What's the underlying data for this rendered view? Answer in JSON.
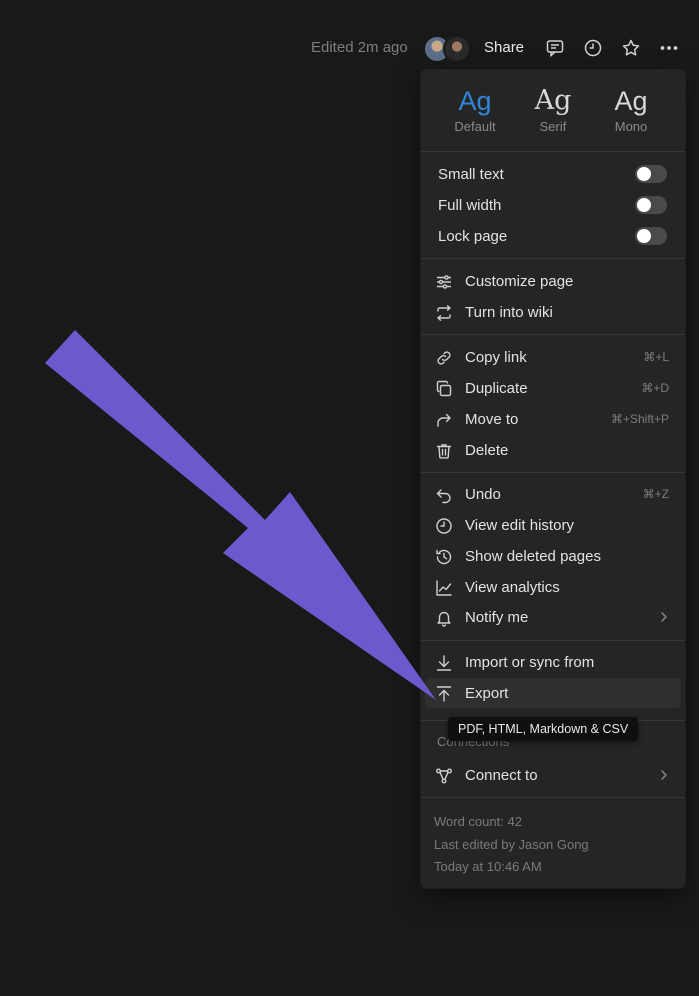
{
  "topbar": {
    "edited": "Edited 2m ago",
    "share": "Share",
    "icons": [
      "comment-icon",
      "clock-icon",
      "star-icon",
      "more-icon"
    ]
  },
  "menu": {
    "fonts": [
      {
        "glyph": "Ag",
        "label": "Default",
        "selected": true
      },
      {
        "glyph": "Ag",
        "label": "Serif",
        "selected": false
      },
      {
        "glyph": "Ag",
        "label": "Mono",
        "selected": false
      }
    ],
    "toggles": [
      {
        "label": "Small text",
        "on": false
      },
      {
        "label": "Full width",
        "on": false
      },
      {
        "label": "Lock page",
        "on": false
      }
    ],
    "group1": [
      {
        "label": "Customize page",
        "icon": "sliders-icon"
      },
      {
        "label": "Turn into wiki",
        "icon": "convert-icon"
      }
    ],
    "group2": [
      {
        "label": "Copy link",
        "icon": "link-icon",
        "shortcut": "⌘+L"
      },
      {
        "label": "Duplicate",
        "icon": "duplicate-icon",
        "shortcut": "⌘+D"
      },
      {
        "label": "Move to",
        "icon": "move-arrow-icon",
        "shortcut": "⌘+Shift+P"
      },
      {
        "label": "Delete",
        "icon": "trash-icon",
        "shortcut": ""
      }
    ],
    "group3": [
      {
        "label": "Undo",
        "icon": "undo-icon",
        "shortcut": "⌘+Z"
      },
      {
        "label": "View edit history",
        "icon": "clock-icon",
        "shortcut": ""
      },
      {
        "label": "Show deleted pages",
        "icon": "history-icon",
        "shortcut": ""
      },
      {
        "label": "View analytics",
        "icon": "chart-line-icon",
        "shortcut": ""
      },
      {
        "label": "Notify me",
        "icon": "bell-icon",
        "shortcut": ""
      }
    ],
    "group4": [
      {
        "label": "Import or sync from",
        "icon": "import-icon"
      },
      {
        "label": "Export",
        "icon": "export-icon"
      }
    ],
    "connections_header": "Connections",
    "connect_to": "Connect to",
    "footer": {
      "word_count": "Word count: 42",
      "last_edited": "Last edited by Jason Gong",
      "timestamp": "Today at 10:46 AM"
    }
  },
  "tooltip": "PDF, HTML, Markdown & CSV",
  "colors": {
    "background": "#191919",
    "menu": "#252525",
    "accent": "#2f86d9",
    "arrow": "#6a5acd"
  }
}
